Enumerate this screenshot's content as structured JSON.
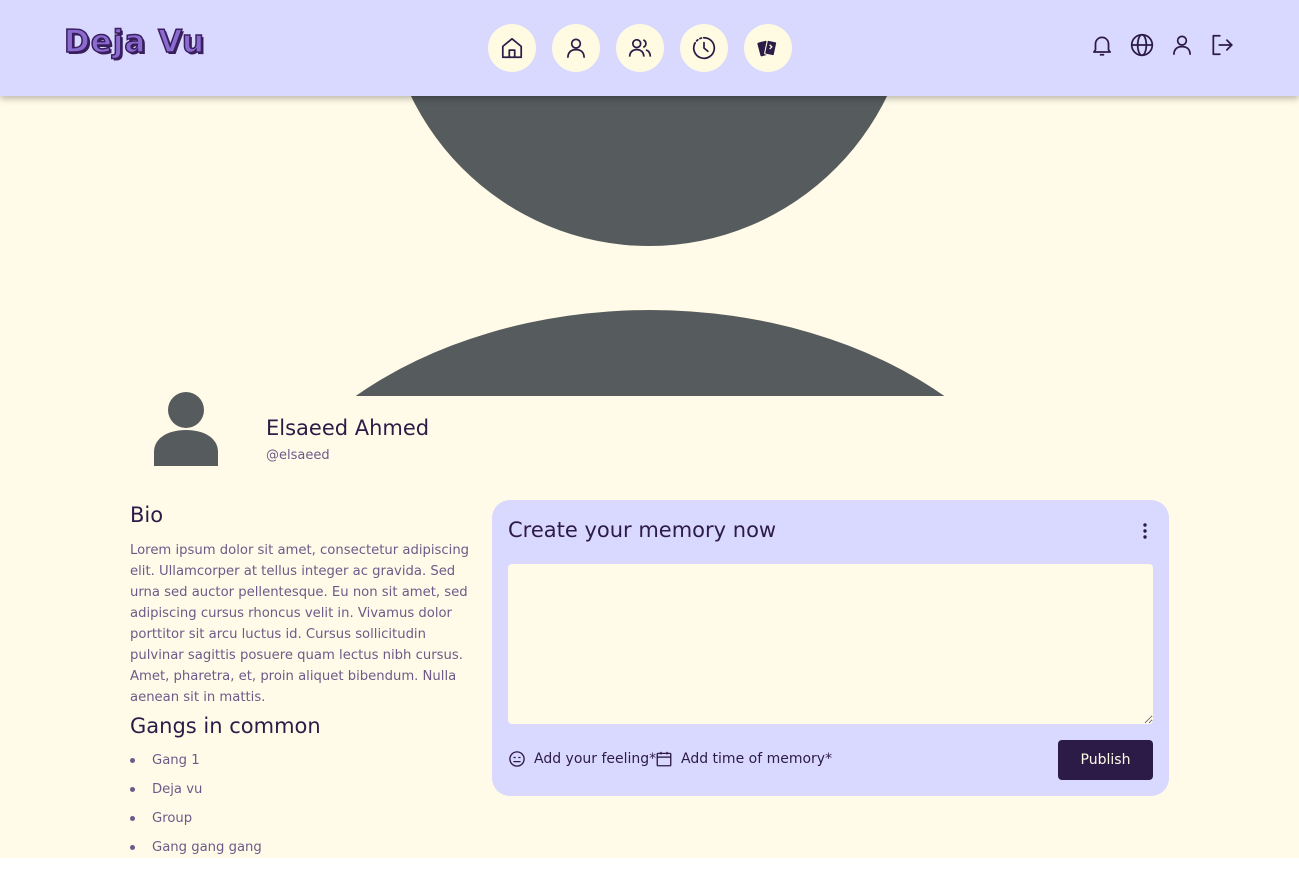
{
  "header": {
    "logo": "Deja Vu",
    "nav": [
      {
        "icon": "home-icon"
      },
      {
        "icon": "user-icon"
      },
      {
        "icon": "users-icon"
      },
      {
        "icon": "clock-icon"
      },
      {
        "icon": "cards-icon"
      }
    ],
    "right_icons": [
      "bell-icon",
      "globe-icon",
      "user-icon",
      "logout-icon"
    ]
  },
  "profile": {
    "name": "Elsaeed Ahmed",
    "handle": "@elsaeed"
  },
  "bio": {
    "title": "Bio",
    "text": "Lorem ipsum dolor sit amet, consectetur adipiscing elit. Ullamcorper at tellus integer ac gravida. Sed urna sed auctor pellentesque. Eu non sit amet, sed adipiscing cursus rhoncus velit in. Vivamus dolor porttitor sit arcu luctus id. Cursus sollicitudin pulvinar sagittis posuere quam lectus nibh cursus. Amet, pharetra, et, proin aliquet bibendum. Nulla aenean sit in mattis."
  },
  "gangs": {
    "title": "Gangs in common",
    "items": [
      "Gang 1",
      "Deja vu",
      "Group",
      "Gang gang gang"
    ]
  },
  "memory": {
    "title": "Create your memory now",
    "input_value": "",
    "feeling_label": "Add your feeling*",
    "time_label": "Add time of memory*",
    "publish_label": "Publish"
  },
  "colors": {
    "header_bg": "#d9d8ff",
    "page_bg": "#fffbe8",
    "primary": "#2d1b47",
    "muted_text": "#6e5a8a",
    "placeholder_gray": "#565b5e"
  }
}
